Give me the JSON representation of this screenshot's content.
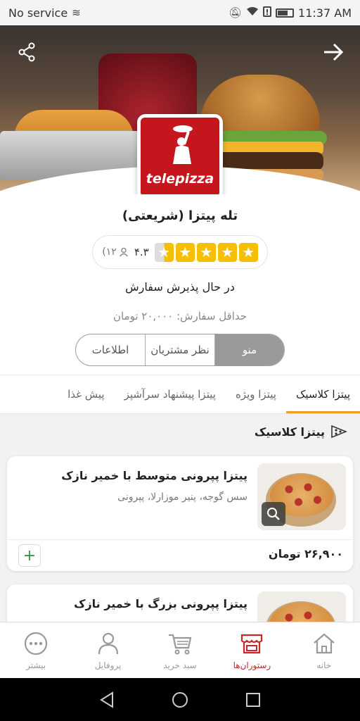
{
  "status_bar": {
    "carrier": "No service",
    "time": "11:37 AM"
  },
  "hero": {
    "logo_text": "telepizza"
  },
  "restaurant": {
    "name": "تله پیتزا (شریعتی)",
    "rating": "۴.۳",
    "rating_count": "(۱۲",
    "rating_stars": 4.3,
    "status": "در حال پذیرش سفارش",
    "min_order": "حداقل سفارش: ۲۰,۰۰۰ تومان"
  },
  "segments": [
    {
      "label": "منو",
      "active": true
    },
    {
      "label": "نظر مشتریان",
      "active": false
    },
    {
      "label": "اطلاعات",
      "active": false
    }
  ],
  "tabs": [
    {
      "label": "پیتزا کلاسیک",
      "active": true
    },
    {
      "label": "پیتزا ویژه",
      "active": false
    },
    {
      "label": "پیتزا پیشنهاد سرآشپز",
      "active": false
    },
    {
      "label": "پیش غذا",
      "active": false
    }
  ],
  "section": {
    "title": "پیتزا کلاسیک"
  },
  "items": [
    {
      "title": "پیتزا پپرونی متوسط با خمیر نازک",
      "description": "سس گوجه، پنیر موزارلا، پپرونی",
      "price": "۲۶,۹۰۰ تومان"
    },
    {
      "title": "پیتزا پپرونی بزرگ با خمیر نازک"
    }
  ],
  "bottom_nav": [
    {
      "label": "خانه",
      "icon": "home-icon",
      "active": false
    },
    {
      "label": "رستوران‌ها",
      "icon": "store-icon",
      "active": true
    },
    {
      "label": "سبد خرید",
      "icon": "cart-icon",
      "active": false
    },
    {
      "label": "پروفایل",
      "icon": "profile-icon",
      "active": false
    },
    {
      "label": "بیشتر",
      "icon": "more-icon",
      "active": false
    }
  ],
  "colors": {
    "accent": "#f0a020",
    "brand": "#c4161c",
    "active_nav": "#c62828",
    "add_green": "#2e9a3a",
    "star": "#f6c000"
  }
}
